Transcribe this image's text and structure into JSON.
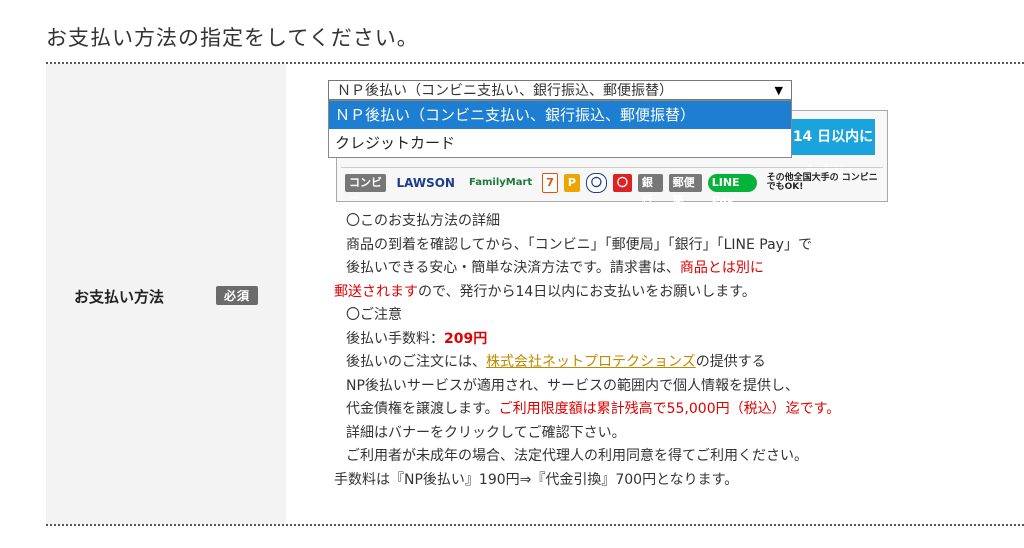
{
  "page_title": "お支払い方法の指定をしてください。",
  "field": {
    "label": "お支払い方法",
    "required_badge": "必須"
  },
  "payment_select": {
    "selected_value": "ＮＰ後払い（コンビニ支払い、銀行振込、郵便振替）",
    "arrow": "▼",
    "options": [
      "ＮＰ後払い（コンビニ支払い、銀行振込、郵便振替）",
      "クレジットカード"
    ]
  },
  "banner": {
    "badge": "14 日以内に お支払い",
    "logos": [
      "コンビニ",
      "LAWSON",
      "FamilyMart",
      "7",
      "P",
      "〇",
      "〇",
      "銀行",
      "郵便局",
      "LINE Pay"
    ],
    "note": "その他全国大手の コンビニでもOK!"
  },
  "description": {
    "line1": "〇このお支払方法の詳細",
    "line2": "商品の到着を確認してから、「コンビニ」「郵便局」「銀行」「LINE Pay」で",
    "line3a": "後払いできる安心・簡単な決済方法です。請求書は、",
    "line3b": "商品とは別に",
    "line4a": "郵送されます",
    "line4b": "ので、発行から14日以内にお支払いをお願いします。",
    "line5": "〇ご注意",
    "line6a": "後払い手数料：",
    "line6b": "209円",
    "line7a": "後払いのご注文には、",
    "line7b": "株式会社ネットプロテクションズ",
    "line7c": "の提供する",
    "line8": "NP後払いサービスが適用され、サービスの範囲内で個人情報を提供し、",
    "line9a": "代金債権を譲渡します。",
    "line9b": "ご利用限度額は累計残高で55,000円（税込）迄です。",
    "line10": "詳細はバナーをクリックしてご確認下さい。",
    "line11": "ご利用者が未成年の場合、法定代理人の利用同意を得てご利用ください。",
    "line12": "手数料は『NP後払い』190円⇒『代金引換』700円となります。"
  },
  "colors": {
    "accent_red": "#e00000",
    "selected_option": "#1e7fd2",
    "link": "#c08a00"
  }
}
